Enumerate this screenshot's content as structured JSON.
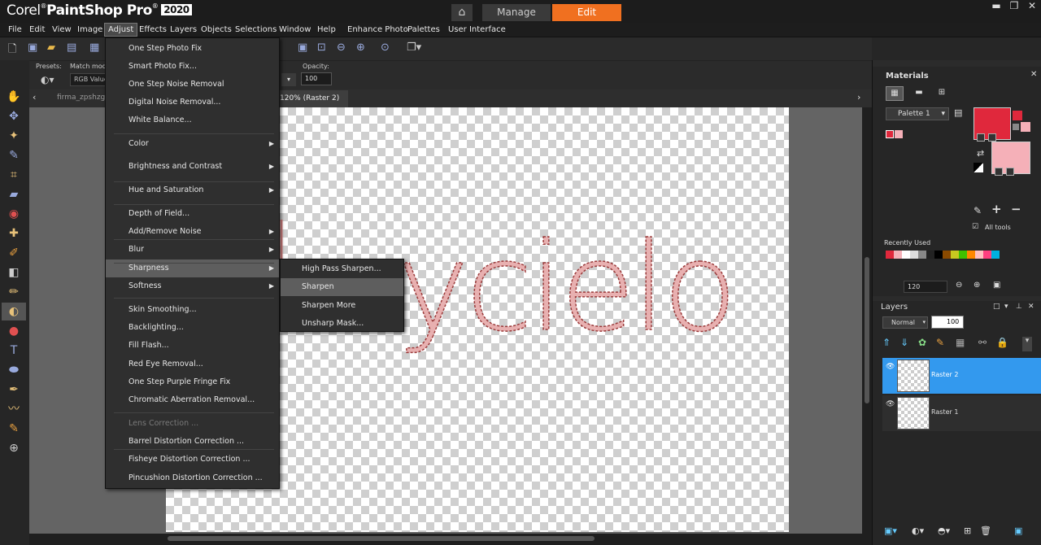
{
  "app": {
    "brand": "Corel",
    "product": "PaintShop Pro",
    "year": "2020"
  },
  "workspace_tabs": {
    "home_icon": "home-icon",
    "manage": "Manage",
    "edit": "Edit",
    "active_color": "#f07020"
  },
  "menu": [
    "File",
    "Edit",
    "View",
    "Image",
    "Adjust",
    "Effects",
    "Layers",
    "Objects",
    "Selections",
    "Window",
    "Help",
    "Enhance Photo",
    "Palettes",
    "User Interface"
  ],
  "options": {
    "presets_label": "Presets:",
    "match_mode_label": "Match mode:",
    "match_mode_value": "RGB Value",
    "opacity_label": "Opacity:",
    "opacity_value": "100"
  },
  "doc_tabs": {
    "tab1": "firma_zpshzgav",
    "tab2": "120% (Raster 2)"
  },
  "canvas_text": "ycielo",
  "adjust_menu": {
    "items": [
      {
        "label": "One Step Photo Fix"
      },
      {
        "label": "Smart Photo Fix..."
      },
      {
        "label": "One Step Noise Removal"
      },
      {
        "label": "Digital Noise Removal..."
      },
      {
        "label": "White Balance..."
      },
      {
        "label": "Color",
        "submenu": true
      },
      {
        "label": "Brightness and Contrast",
        "submenu": true
      },
      {
        "label": "Hue and Saturation",
        "submenu": true
      },
      {
        "label": "Depth of Field..."
      },
      {
        "label": "Add/Remove Noise",
        "submenu": true
      },
      {
        "label": "Blur",
        "submenu": true
      },
      {
        "label": "Sharpness",
        "submenu": true,
        "highlighted": true
      },
      {
        "label": "Softness",
        "submenu": true
      },
      {
        "label": "Skin Smoothing..."
      },
      {
        "label": "Backlighting..."
      },
      {
        "label": "Fill Flash..."
      },
      {
        "label": "Red Eye Removal..."
      },
      {
        "label": "One Step Purple Fringe Fix"
      },
      {
        "label": "Chromatic Aberration Removal..."
      },
      {
        "label": "Lens Correction ...",
        "disabled": true
      },
      {
        "label": "Barrel Distortion Correction ..."
      },
      {
        "label": "Fisheye Distortion Correction ..."
      },
      {
        "label": "Pincushion Distortion Correction ..."
      }
    ]
  },
  "sharpness_submenu": [
    "High Pass Sharpen...",
    "Sharpen",
    "Sharpen More",
    "Unsharp Mask..."
  ],
  "materials": {
    "title": "Materials",
    "palette": "Palette 1",
    "all_tools": "All tools",
    "recently_used": "Recently Used",
    "foreground": "#e0283c",
    "background": "#f5b0b8",
    "recent_colors": [
      "#e0283c",
      "#f5b0b8",
      "#ffffff",
      "#dddddd",
      "#888888",
      "#222222",
      "#000000",
      "#8a4a00",
      "#c8c820",
      "#40c000",
      "#ff8800",
      "#ffc0c0",
      "#ff4080",
      "#00b0e0"
    ]
  },
  "zoom_value": "120",
  "layers": {
    "title": "Layers",
    "blend": "Normal",
    "opacity": "100",
    "items": [
      "Raster 2",
      "Raster 1"
    ],
    "selected_color": "#3399ee"
  }
}
